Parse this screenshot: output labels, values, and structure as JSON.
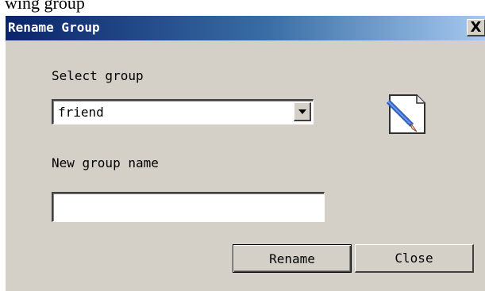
{
  "top_strip": {
    "text": "wing group"
  },
  "window": {
    "title": "Rename Group",
    "close_glyph": "X"
  },
  "form": {
    "select_group_label": "Select group",
    "selected_group": "friend",
    "new_group_name_label": "New group name",
    "new_group_name_value": ""
  },
  "buttons": {
    "rename": "Rename",
    "close": "Close"
  },
  "icons": {
    "document": "document-edit-icon",
    "dropdown": "chevron-down-icon"
  }
}
